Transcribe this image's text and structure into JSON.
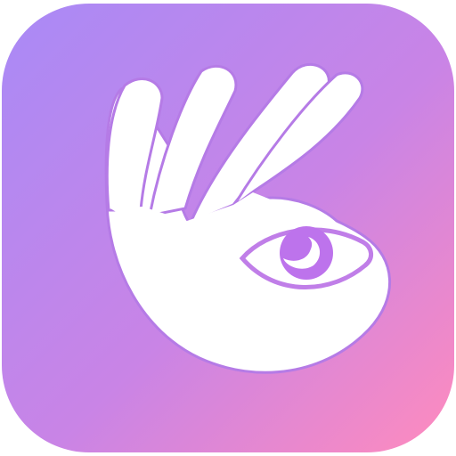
{
  "icon": {
    "name": "ok-hand-eye-app-icon",
    "glyph": "ok-hand-with-eye",
    "colors": {
      "gradient_start": "#a98af6",
      "gradient_mid": "#c984e6",
      "gradient_end": "#ff8bbd",
      "hand": "#ffffff",
      "eye": "#bd73ec",
      "eye_outline": "#c07ee8"
    }
  }
}
